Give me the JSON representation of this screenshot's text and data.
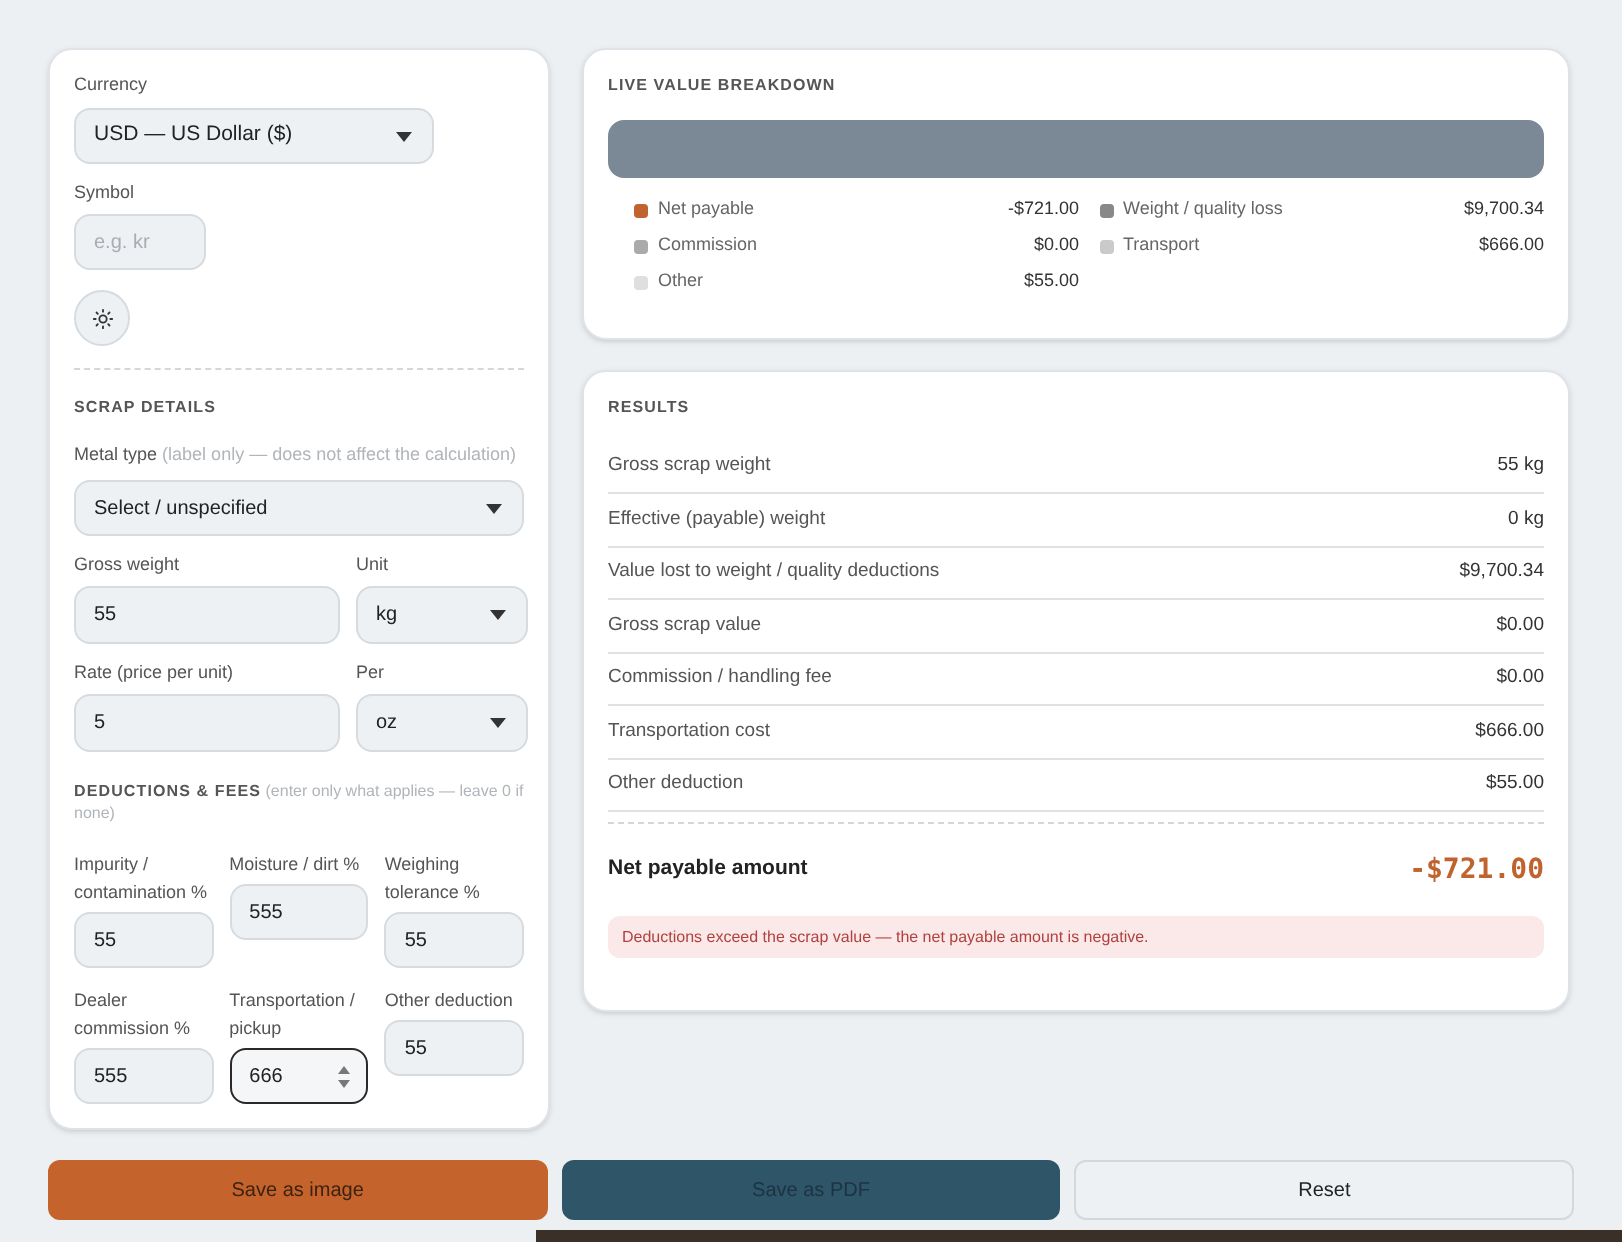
{
  "currency": {
    "label": "Currency",
    "value": "USD — US Dollar ($)"
  },
  "symbol": {
    "label": "Symbol",
    "placeholder": "e.g. kr"
  },
  "scrap_details": {
    "title": "SCRAP DETAILS",
    "metal_type": {
      "label": "Metal type",
      "note": "(label only — does not affect the calculation)",
      "value": "Select / unspecified"
    },
    "fields": [
      {
        "kind": "input",
        "label": "Gross weight",
        "value": "55"
      },
      {
        "kind": "select",
        "label": "Unit",
        "value": "kg"
      },
      {
        "kind": "input",
        "label": "Rate (price per unit)",
        "value": "5"
      },
      {
        "kind": "select",
        "label": "Per",
        "value": "oz"
      }
    ]
  },
  "deductions": {
    "title": "DEDUCTIONS & FEES",
    "note": "(enter only what applies — leave 0 if none)",
    "fields": [
      {
        "label": "Impurity / contamination %",
        "value": "55",
        "focused": false
      },
      {
        "label": "Moisture / dirt %",
        "value": "555",
        "focused": false
      },
      {
        "label": "Weighing tolerance %",
        "value": "55",
        "focused": false
      },
      {
        "label": "Dealer commission %",
        "value": "555",
        "focused": false
      },
      {
        "label": "Transportation / pickup",
        "value": "666",
        "focused": true
      },
      {
        "label": "Other deduction",
        "value": "55",
        "focused": false
      }
    ]
  },
  "breakdown": {
    "title": "LIVE VALUE BREAKDOWN",
    "legend": [
      {
        "label": "Net payable",
        "value": "-$721.00",
        "color": "#c0632f"
      },
      {
        "label": "Weight / quality loss",
        "value": "$9,700.34",
        "color": "#888888"
      },
      {
        "label": "Commission",
        "value": "$0.00",
        "color": "#aaaaaa"
      },
      {
        "label": "Transport",
        "value": "$666.00",
        "color": "#cacaca"
      },
      {
        "label": "Other",
        "value": "$55.00",
        "color": "#dfdfdf"
      }
    ]
  },
  "results": {
    "title": "RESULTS",
    "rows": [
      {
        "label": "Gross scrap weight",
        "value": "55 kg"
      },
      {
        "label": "Effective (payable) weight",
        "value": "0 kg"
      },
      {
        "label": "Value lost to weight / quality deductions",
        "value": "$9,700.34"
      },
      {
        "label": "Gross scrap value",
        "value": "$0.00"
      },
      {
        "label": "Commission / handling fee",
        "value": "$0.00"
      },
      {
        "label": "Transportation cost",
        "value": "$666.00"
      },
      {
        "label": "Other deduction",
        "value": "$55.00"
      }
    ],
    "net": {
      "label": "Net payable amount",
      "value": "-$721.00"
    },
    "warning": "Deductions exceed the scrap value — the net payable amount is negative."
  },
  "buttons": [
    {
      "label": "Save as image",
      "kind": "primary"
    },
    {
      "label": "Save as PDF",
      "kind": "dark"
    },
    {
      "label": "Reset",
      "kind": "outline"
    }
  ]
}
